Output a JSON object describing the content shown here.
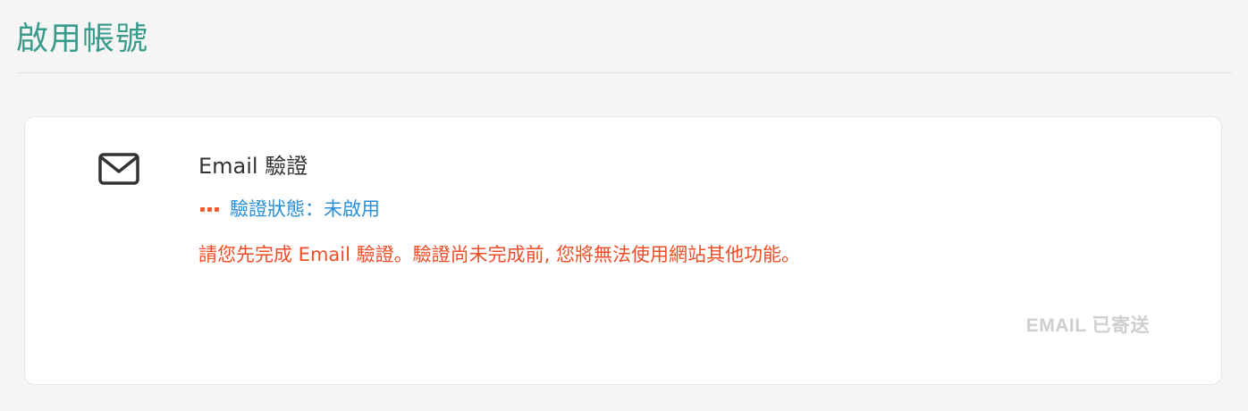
{
  "page": {
    "title": "啟用帳號"
  },
  "email_verification": {
    "icon": "envelope-icon",
    "title": "Email 驗證",
    "status_text": "驗證狀態：未啟用",
    "warning_text": "請您先完成 Email 驗證。驗證尚未完成前, 您將無法使用網站其他功能。",
    "send_button_label": "EMAIL 已寄送"
  },
  "colors": {
    "title_teal": "#3a9b8c",
    "status_blue": "#2a8fd6",
    "warning_red": "#ee4d27",
    "disabled_gray": "#cfcfcf"
  }
}
